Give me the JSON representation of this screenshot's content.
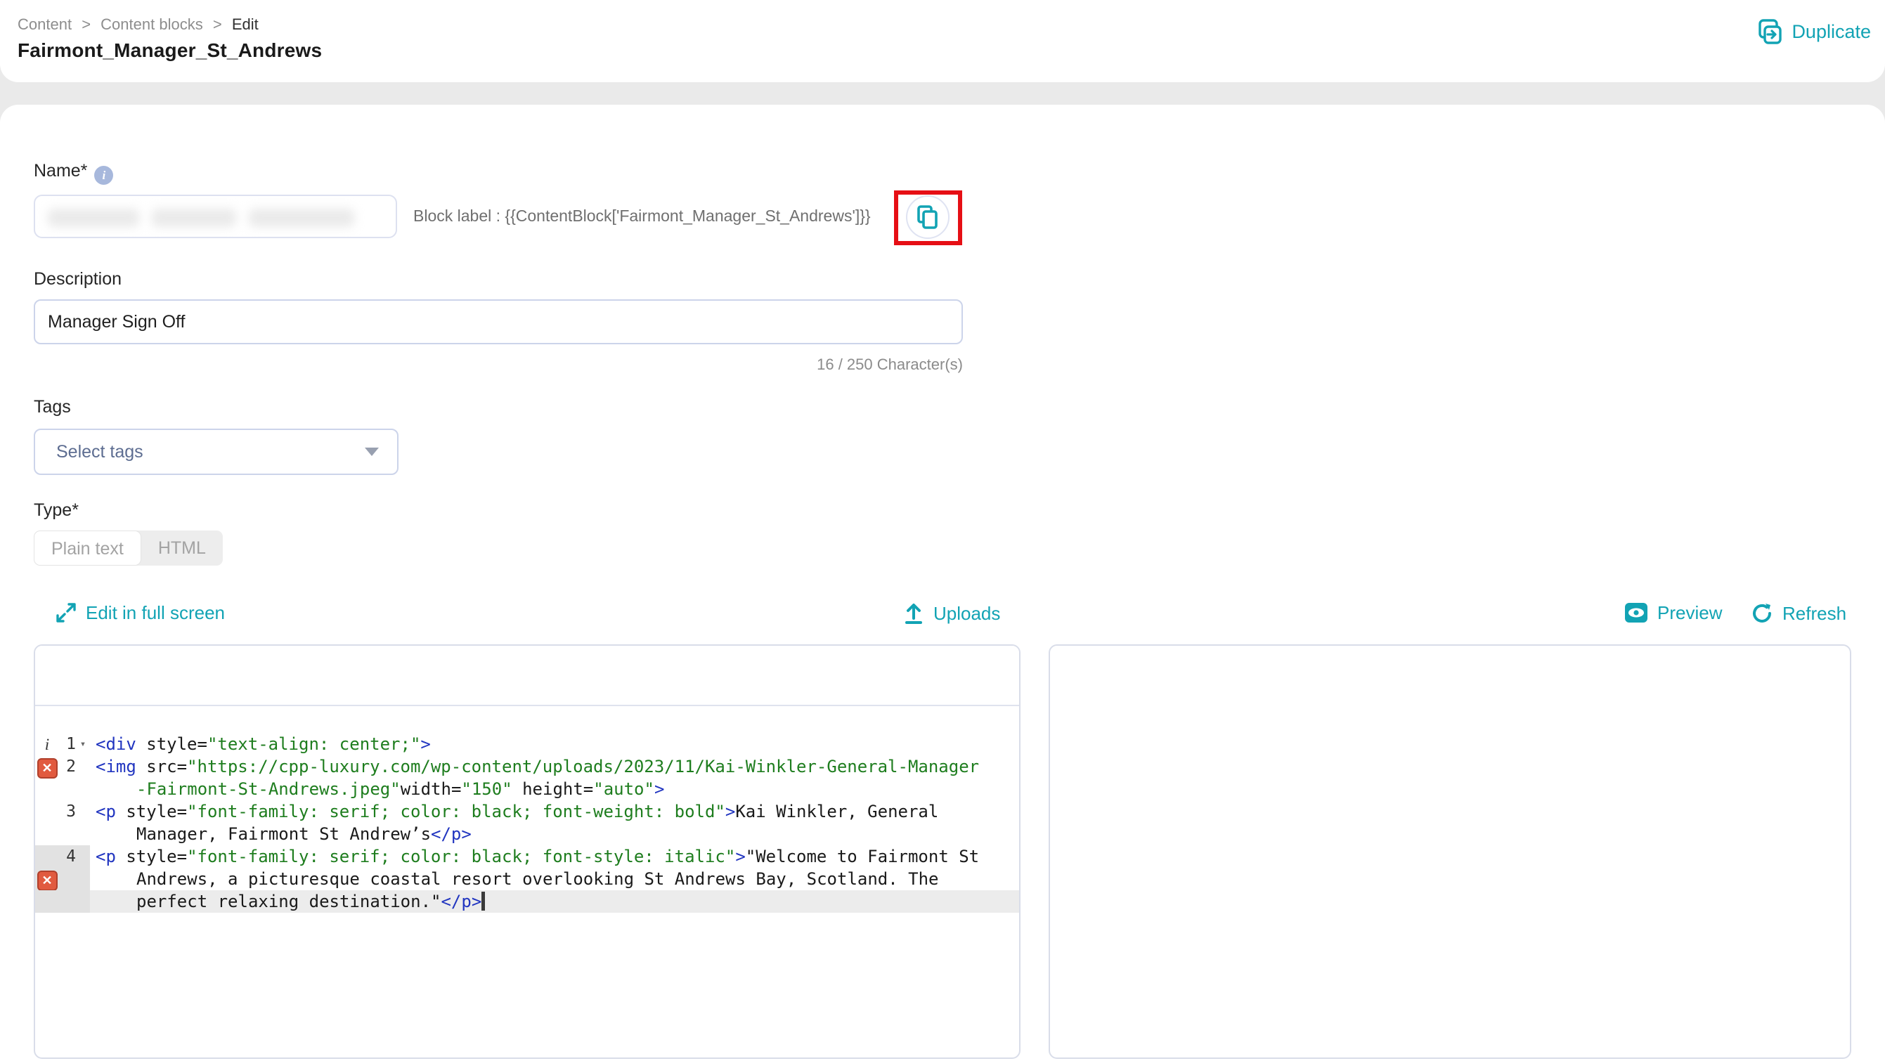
{
  "breadcrumb": {
    "items": [
      "Content",
      "Content blocks",
      "Edit"
    ],
    "separator": ">"
  },
  "page": {
    "title": "Fairmont_Manager_St_Andrews"
  },
  "header_actions": {
    "duplicate_label": "Duplicate",
    "duplicate_icon": "duplicate-icon"
  },
  "form": {
    "name": {
      "label": "Name*",
      "info_icon": "i",
      "value_redacted": true,
      "block_label": "Block label : {{ContentBlock['Fairmont_Manager_St_Andrews']}}",
      "copy_icon": "copy-icon"
    },
    "description": {
      "label": "Description",
      "value": "Manager Sign Off",
      "counter": "16 / 250 Character(s)"
    },
    "tags": {
      "label": "Tags",
      "placeholder": "Select tags"
    },
    "type": {
      "label": "Type*",
      "options": [
        "Plain text",
        "HTML"
      ],
      "selected": "Plain text"
    }
  },
  "editor_toolbar": {
    "edit_full_screen": "Edit in full screen",
    "uploads": "Uploads",
    "preview": "Preview",
    "refresh": "Refresh"
  },
  "editor": {
    "fold_caret": "▾",
    "error_glyph": "✕",
    "info_glyph": "i",
    "rows": [
      {
        "icon": "info",
        "num": "1",
        "caret": true,
        "tokens": [
          [
            "tag",
            "<div"
          ],
          [
            "pl",
            " "
          ],
          [
            "pl",
            "style"
          ],
          [
            "pl",
            "="
          ],
          [
            "st",
            "\"text-align: center;\""
          ],
          [
            "tag",
            ">"
          ]
        ]
      },
      {
        "icon": "error",
        "num": "2",
        "tokens": [
          [
            "tag",
            "<img"
          ],
          [
            "pl",
            " "
          ],
          [
            "pl",
            "src"
          ],
          [
            "pl",
            "="
          ],
          [
            "st",
            "\"https://cpp-luxury.com/wp-content/uploads/2023/11/Kai-Winkler-General-Manager"
          ]
        ]
      },
      {
        "wrap": true,
        "tokens": [
          [
            "st",
            "-Fairmont-St-Andrews.jpeg\""
          ],
          [
            "pl",
            "width"
          ],
          [
            "pl",
            "="
          ],
          [
            "st",
            "\"150\""
          ],
          [
            "pl",
            " "
          ],
          [
            "pl",
            "height"
          ],
          [
            "pl",
            "="
          ],
          [
            "st",
            "\"auto\""
          ],
          [
            "tag",
            ">"
          ]
        ]
      },
      {
        "num": "3",
        "tokens": [
          [
            "tag",
            "<p"
          ],
          [
            "pl",
            " "
          ],
          [
            "pl",
            "style"
          ],
          [
            "pl",
            "="
          ],
          [
            "st",
            "\"font-family: serif; color: black; font-weight: bold\""
          ],
          [
            "tag",
            ">"
          ],
          [
            "pl",
            "Kai Winkler, General"
          ]
        ]
      },
      {
        "wrap": true,
        "tokens": [
          [
            "pl",
            "Manager, Fairmont St Andrew’s"
          ],
          [
            "tag",
            "</p>"
          ]
        ]
      },
      {
        "num": "4",
        "hlGutter": true,
        "tokens": [
          [
            "tag",
            "<p"
          ],
          [
            "pl",
            " "
          ],
          [
            "pl",
            "style"
          ],
          [
            "pl",
            "="
          ],
          [
            "st",
            "\"font-family: serif; color: black; font-style: italic\""
          ],
          [
            "tag",
            ">"
          ],
          [
            "pl",
            "\"Welcome to Fairmont St"
          ]
        ]
      },
      {
        "icon": "error",
        "wrap": true,
        "hlGutter": true,
        "tokens": [
          [
            "pl",
            "Andrews, a picturesque coastal resort overlooking St Andrews Bay, Scotland. The"
          ]
        ]
      },
      {
        "wrap": true,
        "hlGutter": true,
        "hlRow": true,
        "cursor": true,
        "tokens": [
          [
            "pl",
            "perfect relaxing destination.\""
          ],
          [
            "tag",
            "</p>"
          ]
        ]
      }
    ]
  },
  "colors": {
    "accent_teal": "#12a3b4",
    "annotation_red": "#e60f15",
    "error_icon": "#e15a3f",
    "code_tag_blue": "#2135c0",
    "code_string_green": "#1e7d1e"
  }
}
